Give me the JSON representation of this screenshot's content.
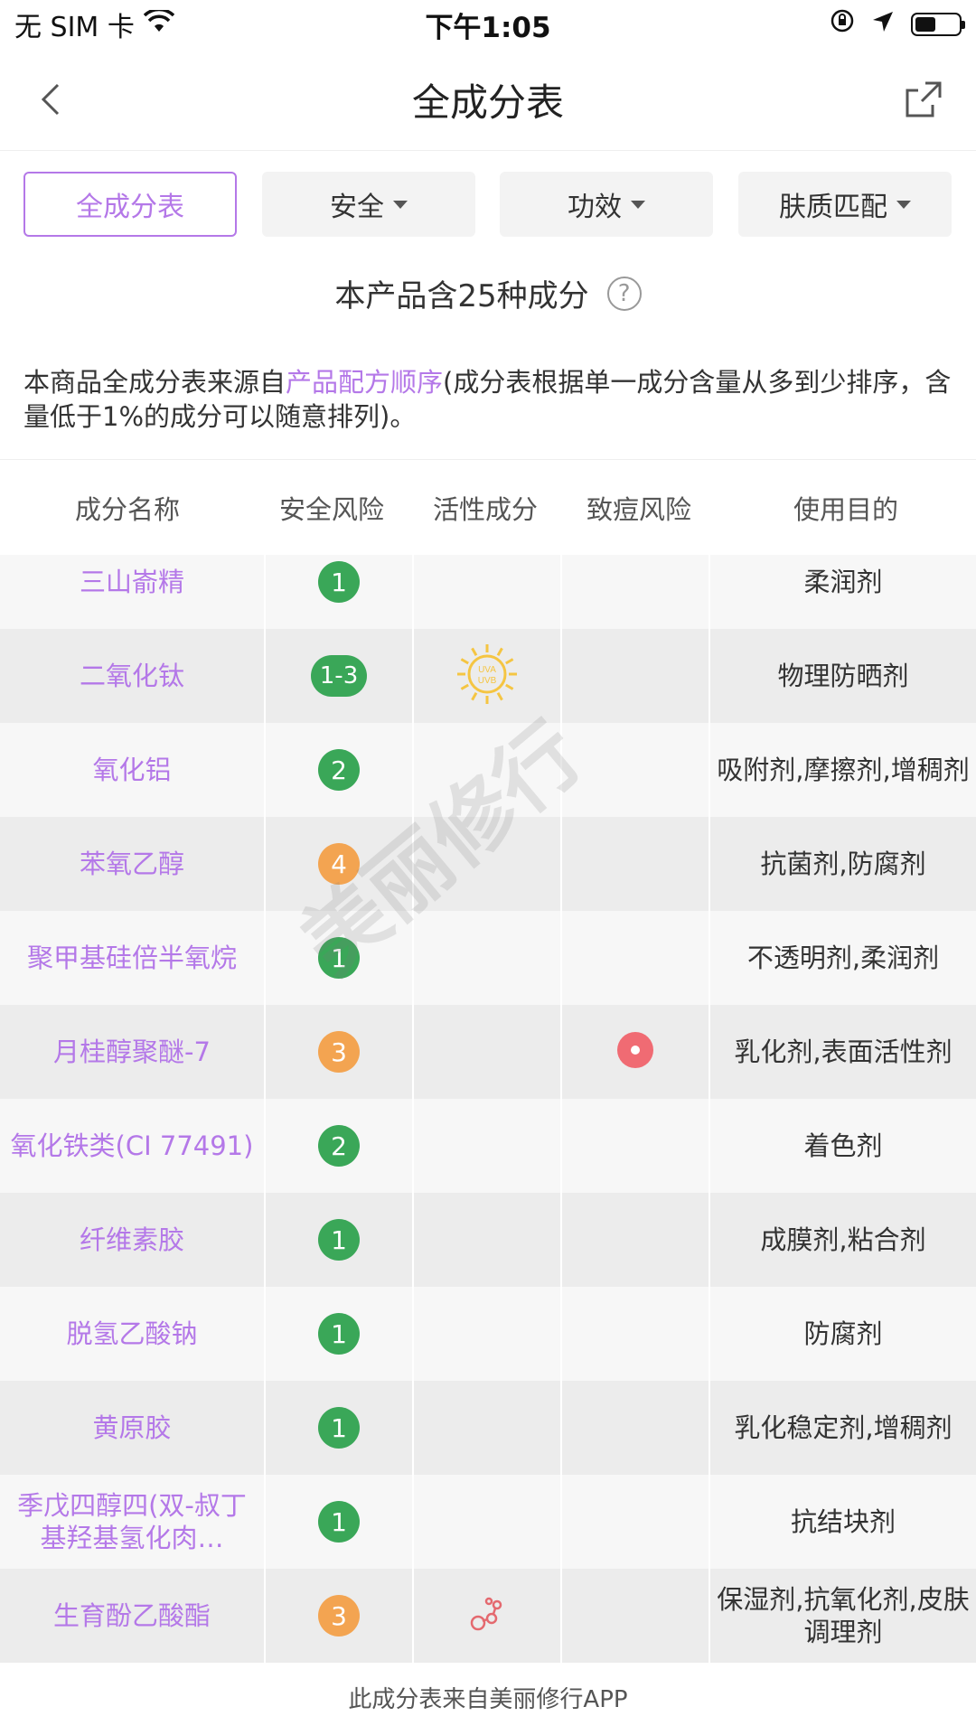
{
  "status": {
    "carrier": "无 SIM 卡",
    "time": "下午1:05"
  },
  "nav": {
    "title": "全成分表"
  },
  "filters": [
    {
      "label": "全成分表",
      "active": true
    },
    {
      "label": "安全"
    },
    {
      "label": "功效"
    },
    {
      "label": "肤质匹配"
    }
  ],
  "summary": {
    "text": "本产品含25种成分"
  },
  "description": {
    "prefix": "本商品全成分表来源自",
    "link": "产品配方顺序",
    "suffix": "(成分表根据单一成分含量从多到少排序，含量低于1%的成分可以随意排列)。"
  },
  "table": {
    "headers": [
      "成分名称",
      "安全风险",
      "活性成分",
      "致痘风险",
      "使用目的"
    ],
    "rows": [
      {
        "name": "三山嵛精",
        "risk": "1",
        "color": "#3aa758",
        "active_icon": "",
        "acne": false,
        "use": "柔润剂"
      },
      {
        "name": "二氧化钛",
        "risk": "1-3",
        "color": "#3aa758",
        "active_icon": "uva-uvb-sun-icon",
        "acne": false,
        "use": "物理防晒剂"
      },
      {
        "name": "氧化铝",
        "risk": "2",
        "color": "#3aa758",
        "active_icon": "",
        "acne": false,
        "use": "吸附剂,摩擦剂,增稠剂"
      },
      {
        "name": "苯氧乙醇",
        "risk": "4",
        "color": "#f3a451",
        "active_icon": "",
        "acne": false,
        "use": "抗菌剂,防腐剂"
      },
      {
        "name": "聚甲基硅倍半氧烷",
        "risk": "1",
        "color": "#3aa758",
        "active_icon": "",
        "acne": false,
        "use": "不透明剂,柔润剂"
      },
      {
        "name": "月桂醇聚醚-7",
        "risk": "3",
        "color": "#f3a451",
        "active_icon": "",
        "acne": true,
        "use": "乳化剂,表面活性剂"
      },
      {
        "name": "氧化铁类(CI 77491)",
        "risk": "2",
        "color": "#3aa758",
        "active_icon": "",
        "acne": false,
        "use": "着色剂"
      },
      {
        "name": "纤维素胶",
        "risk": "1",
        "color": "#3aa758",
        "active_icon": "",
        "acne": false,
        "use": "成膜剂,粘合剂"
      },
      {
        "name": "脱氢乙酸钠",
        "risk": "1",
        "color": "#3aa758",
        "active_icon": "",
        "acne": false,
        "use": "防腐剂"
      },
      {
        "name": "黄原胶",
        "risk": "1",
        "color": "#3aa758",
        "active_icon": "",
        "acne": false,
        "use": "乳化稳定剂,增稠剂"
      },
      {
        "name": "季戊四醇四(双-叔丁基羟基氢化肉…",
        "risk": "1",
        "color": "#3aa758",
        "active_icon": "",
        "acne": false,
        "use": "抗结块剂"
      },
      {
        "name": "生育酚乙酸酯",
        "risk": "3",
        "color": "#f3a451",
        "active_icon": "antioxidant-icon",
        "acne": false,
        "use": "保湿剂,抗氧化剂,皮肤调理剂"
      }
    ]
  },
  "watermark": "美丽修行",
  "footer": "此成分表来自美丽修行APP"
}
